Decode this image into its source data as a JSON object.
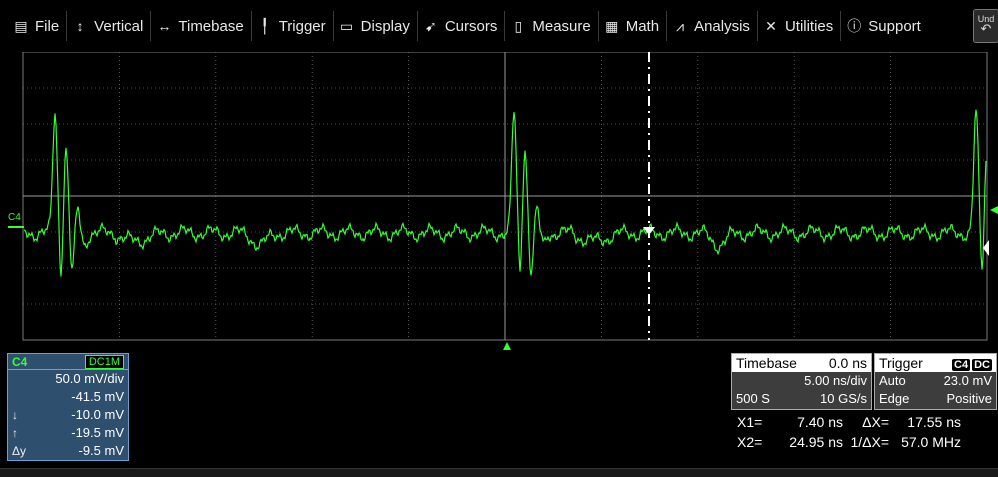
{
  "menu": {
    "items": [
      {
        "id": "file",
        "label": "File",
        "icon": "file-icon",
        "glyph": "▤"
      },
      {
        "id": "vertical",
        "label": "Vertical",
        "icon": "vertical-arrows-icon",
        "glyph": "↕"
      },
      {
        "id": "timebase",
        "label": "Timebase",
        "icon": "horizontal-arrows-icon",
        "glyph": "↔"
      },
      {
        "id": "trigger",
        "label": "Trigger",
        "icon": "trigger-icon",
        "glyph": "╿"
      },
      {
        "id": "display",
        "label": "Display",
        "icon": "display-icon",
        "glyph": "▭"
      },
      {
        "id": "cursors",
        "label": "Cursors",
        "icon": "cursor-arrow-icon",
        "glyph": "➹"
      },
      {
        "id": "measure",
        "label": "Measure",
        "icon": "measure-icon",
        "glyph": "▯"
      },
      {
        "id": "math",
        "label": "Math",
        "icon": "calculator-icon",
        "glyph": "▦"
      },
      {
        "id": "analysis",
        "label": "Analysis",
        "icon": "analysis-chart-icon",
        "glyph": "⩘"
      },
      {
        "id": "utilities",
        "label": "Utilities",
        "icon": "tools-icon",
        "glyph": "✕"
      },
      {
        "id": "support",
        "label": "Support",
        "icon": "info-icon",
        "glyph": "ⓘ"
      }
    ],
    "undo_label": "Und",
    "undo_glyph": "↶"
  },
  "trace": {
    "channel_marker": "C4",
    "color": "#33ff33"
  },
  "channel": {
    "name": "C4",
    "coupling": "DC1M",
    "scale": "50.0 mV/div",
    "offset": "-41.5 mV",
    "cursor1_icon": "↓",
    "cursor1": "-10.0 mV",
    "cursor2_icon": "↑",
    "cursor2": "-19.5 mV",
    "delta_label": "Δy",
    "delta": "-9.5 mV"
  },
  "timebase": {
    "title": "Timebase",
    "delay": "0.0 ns",
    "scale": "5.00 ns/div",
    "samples": "500 S",
    "rate": "10 GS/s"
  },
  "trigger": {
    "title": "Trigger",
    "source_badge": "C4",
    "coupling_badge": "DC",
    "mode": "Auto",
    "level": "23.0 mV",
    "type": "Edge",
    "slope": "Positive"
  },
  "cursor_readout": {
    "x1_label": "X1=",
    "x1": "7.40 ns",
    "dx_label": "ΔX=",
    "dx": "17.55 ns",
    "x2_label": "X2=",
    "x2": "24.95 ns",
    "inv_dx_label": "1/ΔX=",
    "inv_dx": "57.0 MHz"
  },
  "colors": {
    "grid": "#6b6b6b",
    "trace": "#33ff33",
    "channel_bg": "#2f4f6e"
  }
}
